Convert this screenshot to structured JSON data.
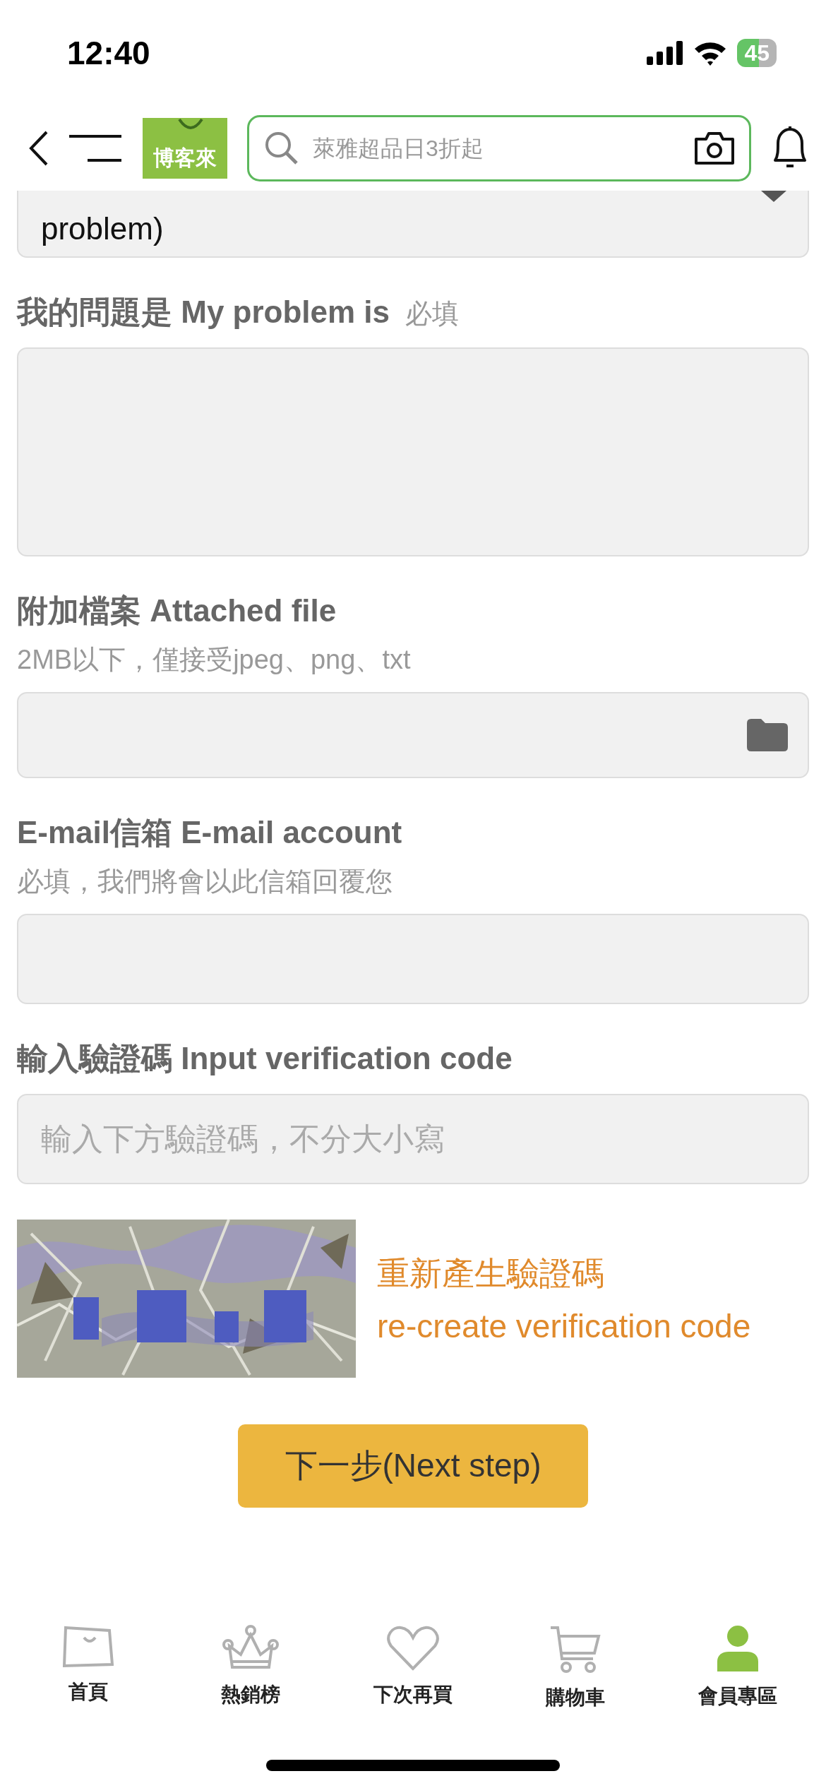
{
  "status_bar": {
    "time": "12:40",
    "battery": "45"
  },
  "header": {
    "logo": "博客來",
    "search": {
      "placeholder": "萊雅超品日3折起"
    }
  },
  "form": {
    "problem_type": {
      "value": "problem)"
    },
    "fields": [
      {
        "kind": "textarea",
        "label": "我的問題是 My problem is",
        "required": "必填"
      },
      {
        "kind": "file",
        "label": "附加檔案 Attached file",
        "hint": "2MB以下，僅接受jpeg、png、txt"
      },
      {
        "kind": "text",
        "label": "E-mail信箱 E-mail account",
        "hint": "必填，我們將會以此信箱回覆您"
      },
      {
        "kind": "text",
        "label": "輸入驗證碼 Input verification code",
        "placeholder": "輸入下方驗證碼，不分大小寫"
      }
    ],
    "captcha": {
      "kind": "picture",
      "regenerate": [
        "重新產生驗證碼",
        "re-create verification code"
      ]
    },
    "next_button": "下一步(Next step)"
  },
  "tab_bar": [
    {
      "label": "首頁",
      "selected": false
    },
    {
      "label": "熱銷榜",
      "selected": false
    },
    {
      "label": "下次再買",
      "selected": false
    },
    {
      "label": "購物車",
      "selected": false
    },
    {
      "label": "會員專區",
      "selected": true
    }
  ]
}
